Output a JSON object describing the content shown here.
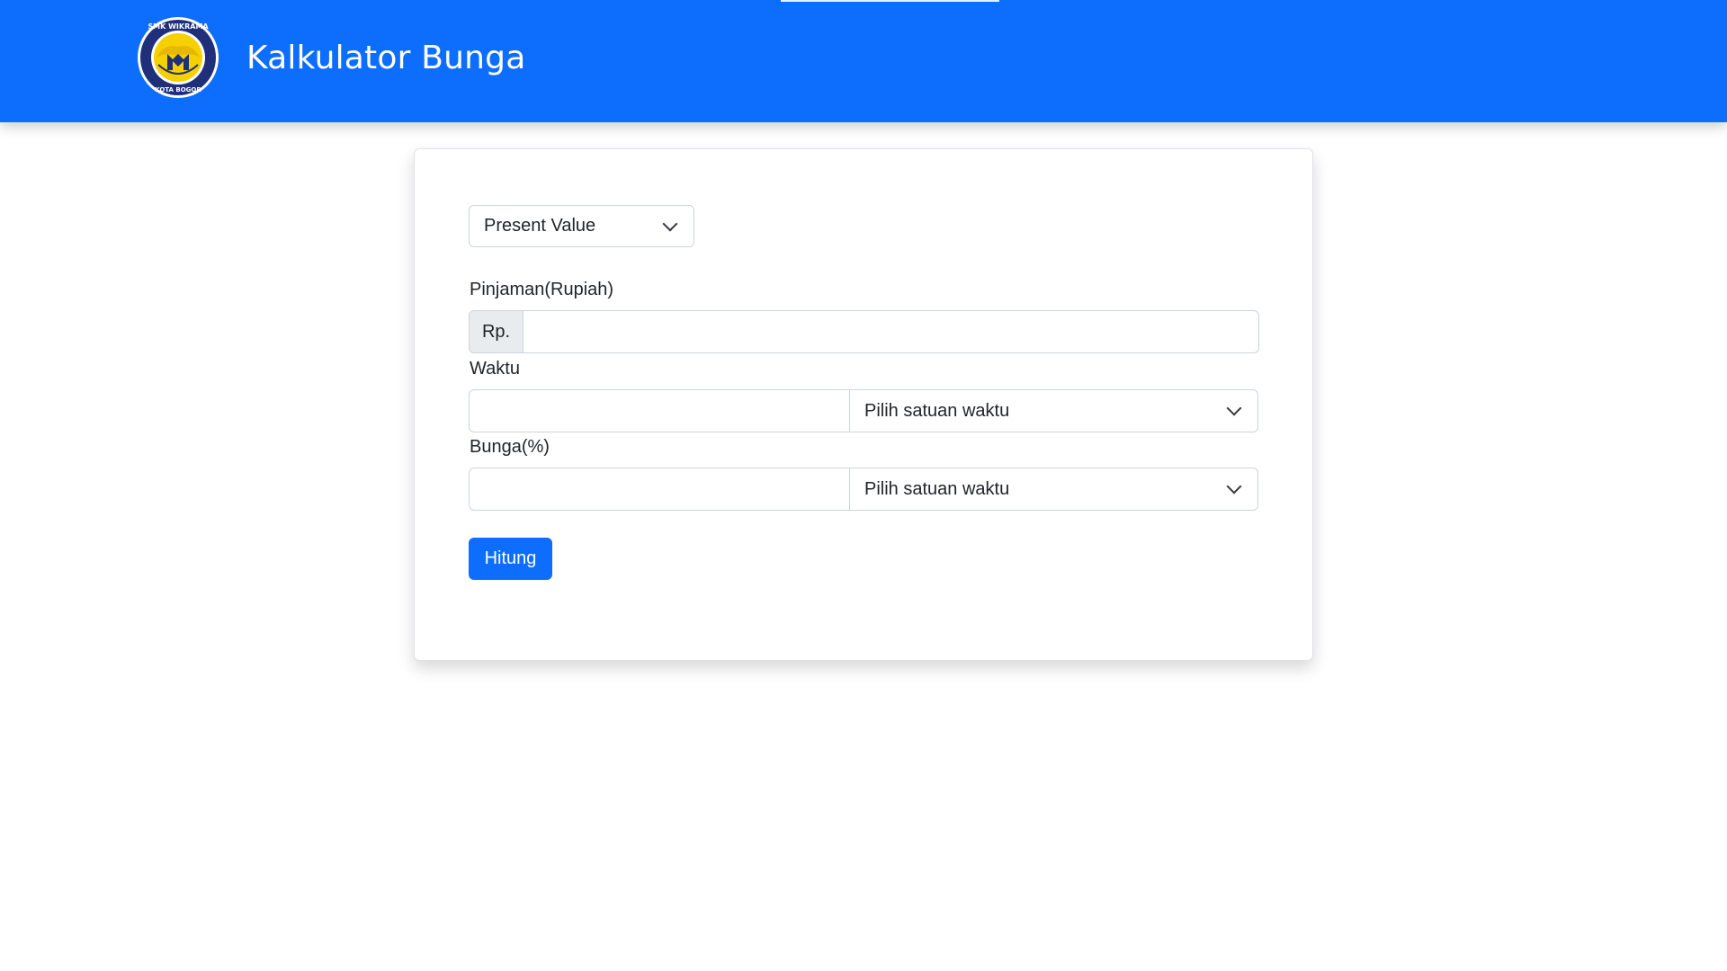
{
  "header": {
    "title": "Kalkulator Bunga",
    "logo_icon": "school-logo-icon",
    "logo_text_top": "SMK WIKRAMA",
    "logo_text_bottom": "KOTA BOGOR",
    "background_color": "#0d6efd"
  },
  "form": {
    "mode_select": {
      "value": "Present Value"
    },
    "pinjaman": {
      "label": "Pinjaman(Rupiah)",
      "prefix": "Rp.",
      "value": ""
    },
    "waktu": {
      "label": "Waktu",
      "value": "",
      "unit_select_value": "Pilih satuan waktu"
    },
    "bunga": {
      "label": "Bunga(%)",
      "value": "",
      "unit_select_value": "Pilih satuan waktu"
    },
    "submit_label": "Hitung",
    "accent_color": "#0d6efd"
  }
}
